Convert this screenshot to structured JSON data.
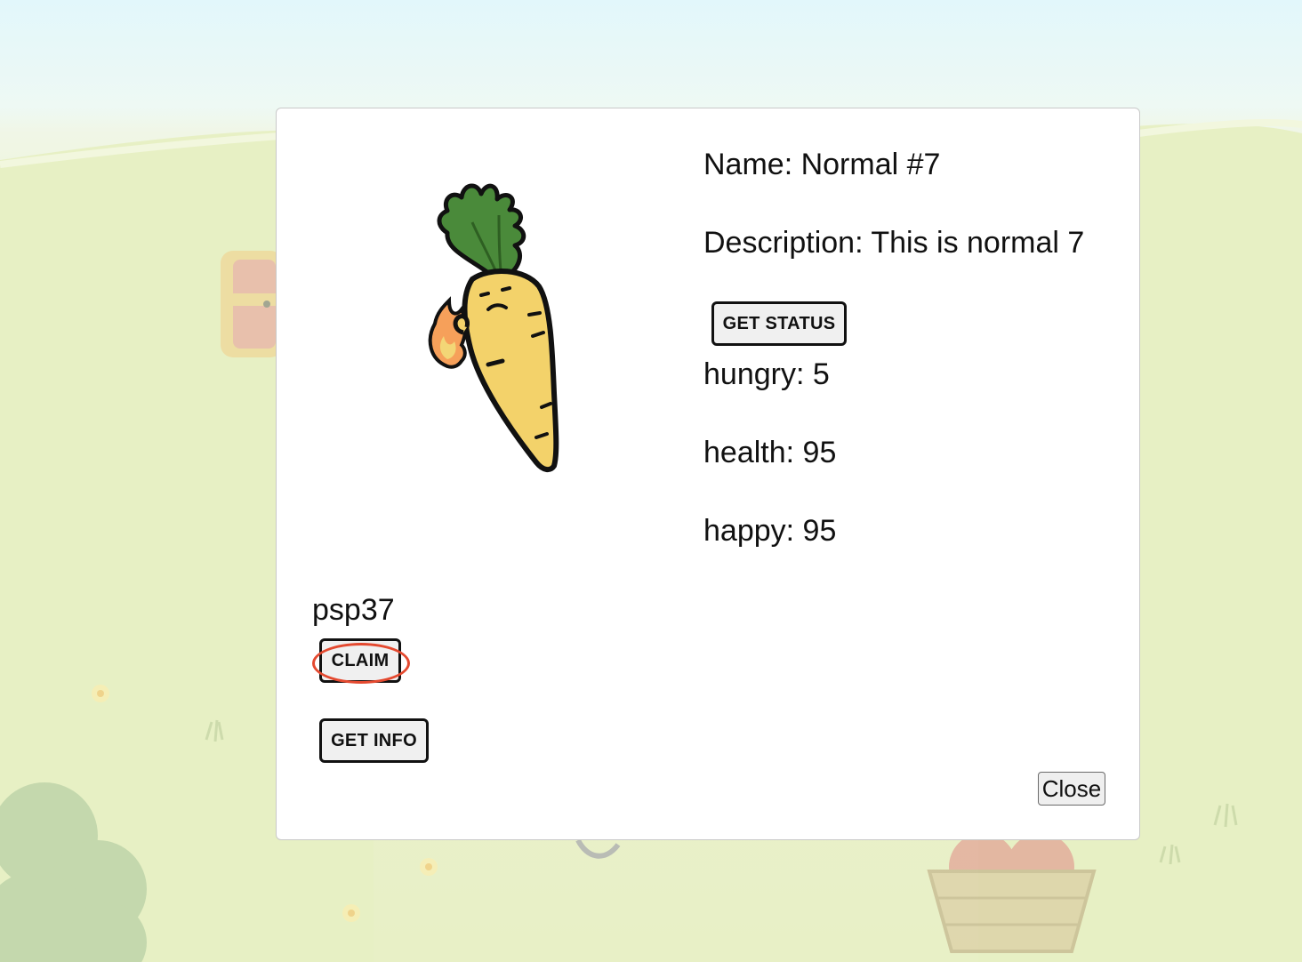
{
  "pet": {
    "name_text": "Name: Normal #7",
    "description_text": "Description: This is normal 7",
    "image_icon": "carrot-character-icon"
  },
  "status": {
    "get_status_label": "GET STATUS",
    "hungry_text": "hungry: 5",
    "health_text": "health: 95",
    "happy_text": "happy: 95"
  },
  "token": {
    "standard_text": "psp37",
    "claim_label": "CLAIM",
    "get_info_label": "GET INFO"
  },
  "modal": {
    "close_label": "Close"
  },
  "colors": {
    "highlight": "#e4492f",
    "modal_bg": "#ffffff",
    "button_bg": "#f0f0f0"
  }
}
